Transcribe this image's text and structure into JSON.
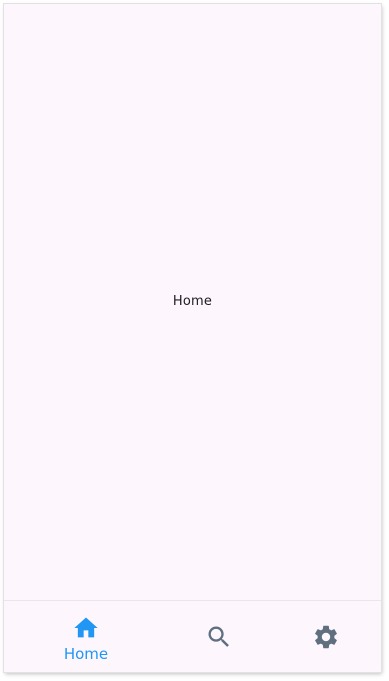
{
  "main": {
    "center_text": "Home"
  },
  "bottom_nav": {
    "items": [
      {
        "label": "Home",
        "icon": "home-icon",
        "selected": true
      },
      {
        "label": "",
        "icon": "search-icon",
        "selected": false
      },
      {
        "label": "",
        "icon": "gear-icon",
        "selected": false
      }
    ]
  },
  "colors": {
    "background": "#fdf7fd",
    "selected": "#2196f3",
    "unselected": "#5f6f7f",
    "text": "#1d1b20"
  }
}
